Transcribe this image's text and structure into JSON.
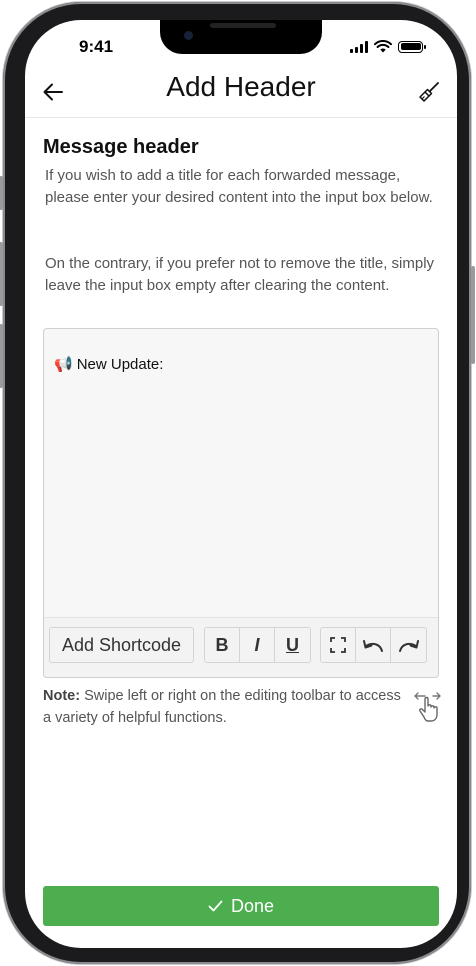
{
  "status_bar": {
    "time": "9:41"
  },
  "appbar": {
    "title": "Add Header",
    "back_icon": "arrow-left-icon",
    "action_icon": "broom-icon"
  },
  "section": {
    "title": "Message header",
    "description_1": "If you wish to add a title for each forwarded message, please enter your desired content into the input box below.",
    "description_2": "On the contrary, if you prefer not to remove the title, simply leave the input box empty after clearing the content."
  },
  "editor": {
    "emoji": "📢",
    "content": "New Update:",
    "toolbar": {
      "shortcode_label": "Add Shortcode",
      "bold": "B",
      "italic": "I",
      "underline": "U"
    }
  },
  "note": {
    "label": "Note:",
    "text": " Swipe left or right on the editing toolbar to access a variety of helpful functions."
  },
  "done_button": {
    "icon": "check-icon",
    "label": "Done"
  },
  "colors": {
    "accent": "#4cae4f"
  }
}
